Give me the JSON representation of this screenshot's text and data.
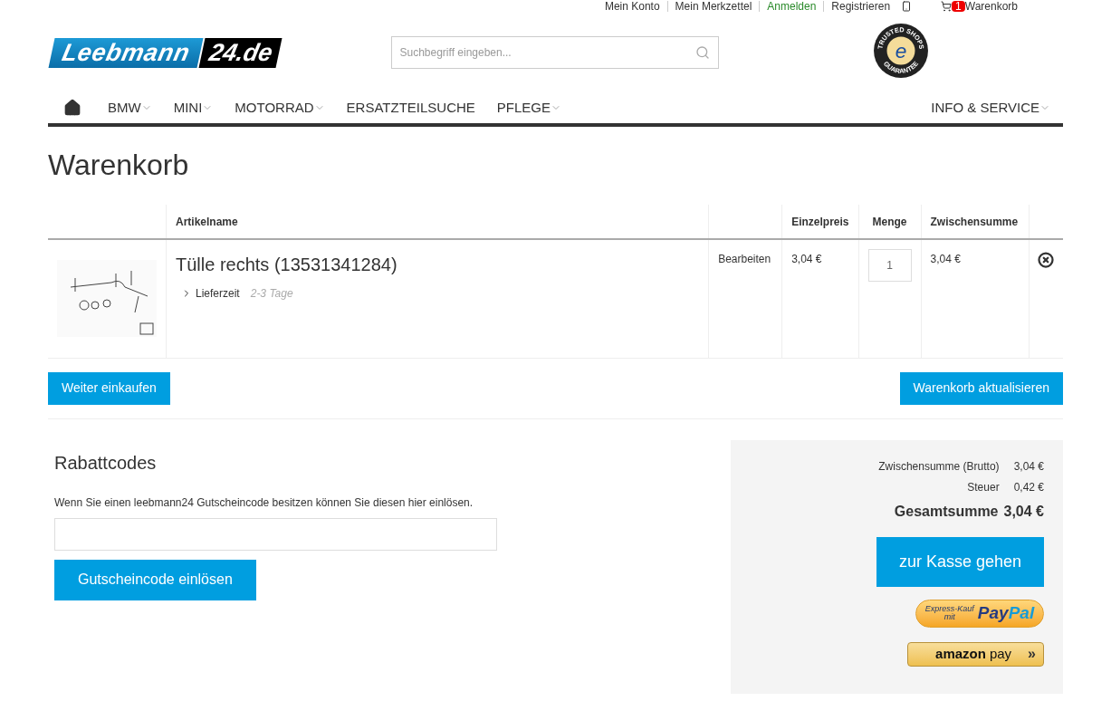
{
  "top_links": [
    "Mein Konto",
    "Mein Merkzettel",
    "Anmelden",
    "Registrieren"
  ],
  "cart_link": {
    "count": "1",
    "label": "Warenkorb"
  },
  "logo": {
    "name": "Leebmann",
    "domain": "24.de"
  },
  "search": {
    "placeholder": "Suchbegriff eingeben..."
  },
  "trust_badge": {
    "top": "TRUSTED SHOPS",
    "bottom": "GUARANTEE",
    "letter": "e"
  },
  "nav": {
    "left": [
      {
        "label": "BMW",
        "dropdown": true
      },
      {
        "label": "MINI",
        "dropdown": true
      },
      {
        "label": "MOTORRAD",
        "dropdown": true
      },
      {
        "label": "ERSATZTEILSUCHE",
        "dropdown": false
      },
      {
        "label": "PFLEGE",
        "dropdown": true
      }
    ],
    "right": [
      {
        "label": "INFO & SERVICE",
        "dropdown": true
      }
    ]
  },
  "page_title": "Warenkorb",
  "table": {
    "columns": [
      "Artikelname",
      "Einzelpreis",
      "Menge",
      "Zwischensumme"
    ],
    "rows": [
      {
        "name": "Tülle rechts (13531341284)",
        "delivery_label": "Lieferzeit",
        "delivery_value": "2-3 Tage",
        "edit": "Bearbeiten",
        "price": "3,04 €",
        "quantity": "1",
        "subtotal": "3,04 €"
      }
    ]
  },
  "continue_button": "Weiter einkaufen",
  "update_button": "Warenkorb aktualisieren",
  "coupon": {
    "title": "Rabattcodes",
    "text": "Wenn Sie einen leebmann24 Gutscheincode besitzen können Sie diesen hier einlösen.",
    "button": "Gutscheincode einlösen"
  },
  "summary": {
    "lines": [
      {
        "label": "Zwischensumme (Brutto)",
        "value": "3,04 €",
        "kind": "normal"
      },
      {
        "label": "Steuer",
        "value": "0,42 €",
        "kind": "normal"
      },
      {
        "label": "Gesamtsumme",
        "value": "3,04 €",
        "kind": "total"
      }
    ],
    "checkout": "zur Kasse gehen",
    "paypal": {
      "line1": "Express-Kauf",
      "line2": "mit",
      "brand1": "Pay",
      "brand2": "Pal"
    },
    "amazon": {
      "brand": "amazon",
      "pay": "pay",
      "arrow": "»"
    }
  }
}
